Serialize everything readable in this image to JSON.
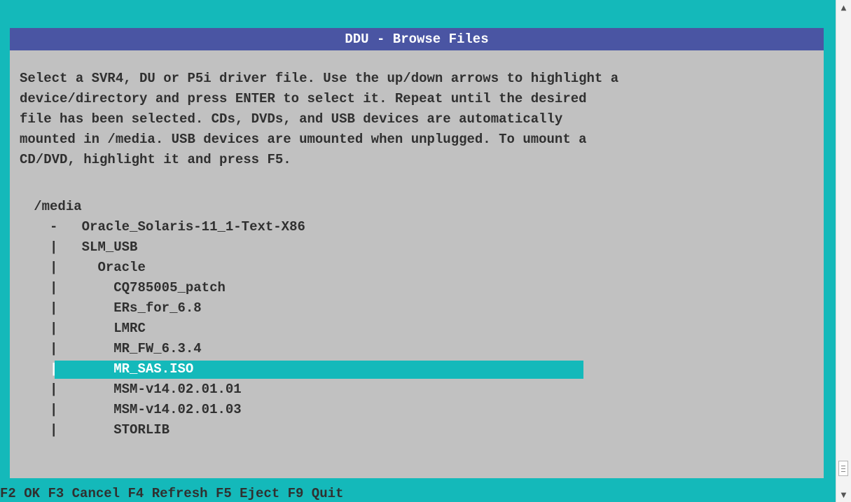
{
  "dialog": {
    "title": "DDU - Browse Files",
    "instructions": [
      "Select a SVR4, DU or P5i driver file. Use the up/down arrows to highlight a",
      "device/directory and press ENTER to select it. Repeat until the desired",
      "file has been selected. CDs, DVDs, and USB devices are automatically",
      "mounted in /media. USB devices are umounted when unplugged. To umount a",
      "CD/DVD, highlight it and press F5."
    ],
    "tree": {
      "root": "/media",
      "items": [
        {
          "prefix": "-",
          "indent": 0,
          "label": "Oracle_Solaris-11_1-Text-X86",
          "selected": false
        },
        {
          "prefix": "|",
          "indent": 0,
          "label": "SLM_USB",
          "selected": false
        },
        {
          "prefix": "|",
          "indent": 1,
          "label": "Oracle",
          "selected": false
        },
        {
          "prefix": "|",
          "indent": 2,
          "label": "CQ785005_patch",
          "selected": false
        },
        {
          "prefix": "|",
          "indent": 2,
          "label": "ERs_for_6.8",
          "selected": false
        },
        {
          "prefix": "|",
          "indent": 2,
          "label": "LMRC",
          "selected": false
        },
        {
          "prefix": "|",
          "indent": 2,
          "label": "MR_FW_6.3.4",
          "selected": false
        },
        {
          "prefix": "|",
          "indent": 2,
          "label": "MR_SAS.ISO",
          "selected": true
        },
        {
          "prefix": "|",
          "indent": 2,
          "label": "MSM-v14.02.01.01",
          "selected": false
        },
        {
          "prefix": "|",
          "indent": 2,
          "label": "MSM-v14.02.01.03",
          "selected": false
        },
        {
          "prefix": "|",
          "indent": 2,
          "label": "STORLIB",
          "selected": false
        }
      ]
    }
  },
  "statusbar": {
    "keys": [
      {
        "key": "F2",
        "action": "OK"
      },
      {
        "key": "F3",
        "action": "Cancel"
      },
      {
        "key": "F4",
        "action": "Refresh"
      },
      {
        "key": "F5",
        "action": "Eject"
      },
      {
        "key": "F9",
        "action": "Quit"
      }
    ]
  },
  "scrollbar": {
    "up_icon": "triangle-up-icon",
    "down_icon": "triangle-down-icon",
    "grip_icon": "grip-lines-icon"
  },
  "colors": {
    "console_bg": "#14b9ba",
    "dialog_bg": "#c1c1c1",
    "titlebar_bg": "#4a55a3",
    "highlight_bg": "#14b9ba",
    "text": "#303030"
  }
}
